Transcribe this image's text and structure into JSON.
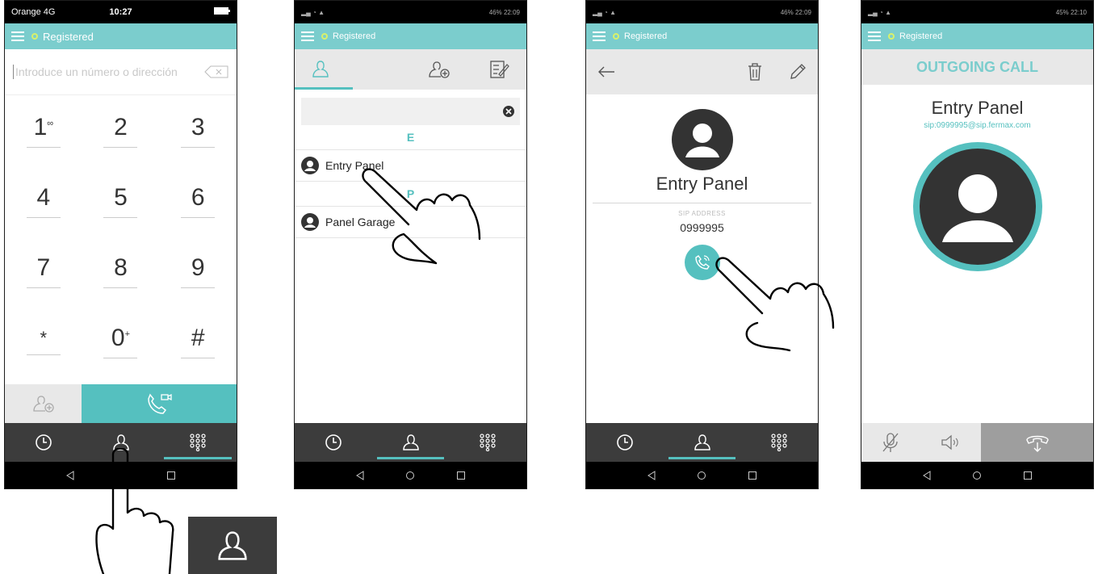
{
  "screen1": {
    "carrier": "Orange 4G",
    "time": "10:27",
    "status": "Registered",
    "placeholder": "Introduce un número o dirección",
    "keys": [
      "1",
      "2",
      "3",
      "4",
      "5",
      "6",
      "7",
      "8",
      "9",
      "*",
      "0",
      "#"
    ],
    "key_sups": {
      "1": "∞",
      "0": "+"
    }
  },
  "screen2": {
    "status_right": "46% 22:09",
    "status": "Registered",
    "section_e": "E",
    "contact_1": "Entry Panel",
    "section_p": "P",
    "contact_2": "Panel Garage"
  },
  "screen3": {
    "status_right": "46% 22:09",
    "status": "Registered",
    "name": "Entry Panel",
    "sip_label": "SIP ADDRESS",
    "sip_number": "0999995"
  },
  "screen4": {
    "status_right": "45% 22:10",
    "status": "Registered",
    "title": "OUTGOING CALL",
    "name": "Entry Panel",
    "sip": "sip:0999995@sip.fermax.com"
  },
  "colors": {
    "accent": "#55c0bf",
    "appbar": "#7bcdcd",
    "nav": "#3c3c3c"
  }
}
